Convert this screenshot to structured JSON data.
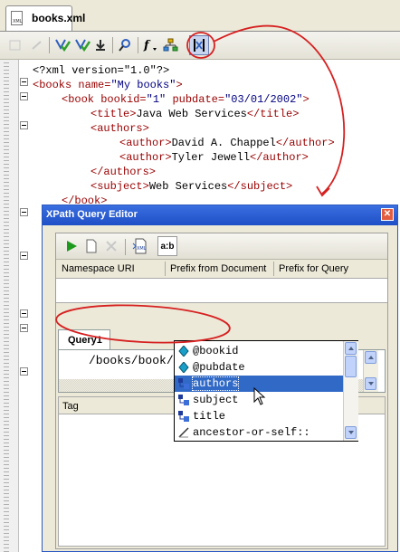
{
  "editor": {
    "tab_label": "books.xml",
    "file_icon_text": "XML",
    "toolbar_icons": [
      "validate-icon",
      "validate-all-icon",
      "insert-icon",
      "search-xpath-icon",
      "function-icon",
      "tree-icon",
      "xpath-query-editor-icon"
    ],
    "code_lines": [
      {
        "indent": 0,
        "parts": [
          {
            "t": "pi",
            "v": "<?xml version=\"1.0\"?>"
          }
        ]
      },
      {
        "indent": 0,
        "parts": [
          {
            "t": "tag",
            "v": "<books "
          },
          {
            "t": "attr",
            "v": "name="
          },
          {
            "t": "val",
            "v": "\"My books\""
          },
          {
            "t": "tag",
            "v": ">"
          }
        ]
      },
      {
        "indent": 1,
        "parts": [
          {
            "t": "tag",
            "v": "<book "
          },
          {
            "t": "attr",
            "v": "bookid="
          },
          {
            "t": "val",
            "v": "\"1\""
          },
          {
            "t": "attr",
            "v": " pubdate="
          },
          {
            "t": "val",
            "v": "\"03/01/2002\""
          },
          {
            "t": "tag",
            "v": ">"
          }
        ]
      },
      {
        "indent": 2,
        "parts": [
          {
            "t": "tag",
            "v": "<title>"
          },
          {
            "t": "txt",
            "v": "Java Web Services"
          },
          {
            "t": "tag",
            "v": "</title>"
          }
        ]
      },
      {
        "indent": 2,
        "parts": [
          {
            "t": "tag",
            "v": "<authors>"
          }
        ]
      },
      {
        "indent": 3,
        "parts": [
          {
            "t": "tag",
            "v": "<author>"
          },
          {
            "t": "txt",
            "v": "David A. Chappel"
          },
          {
            "t": "tag",
            "v": "</author>"
          }
        ]
      },
      {
        "indent": 3,
        "parts": [
          {
            "t": "tag",
            "v": "<author>"
          },
          {
            "t": "txt",
            "v": "Tyler Jewell"
          },
          {
            "t": "tag",
            "v": "</author>"
          }
        ]
      },
      {
        "indent": 2,
        "parts": [
          {
            "t": "tag",
            "v": "</authors>"
          }
        ]
      },
      {
        "indent": 2,
        "parts": [
          {
            "t": "tag",
            "v": "<subject>"
          },
          {
            "t": "txt",
            "v": "Web Services"
          },
          {
            "t": "tag",
            "v": "</subject>"
          }
        ]
      },
      {
        "indent": 1,
        "parts": [
          {
            "t": "tag",
            "v": "</book>"
          }
        ]
      }
    ]
  },
  "dialog": {
    "title": "XPath Query Editor",
    "close_glyph": "✕",
    "toolbar_icons": [
      "run-icon",
      "new-icon",
      "delete-icon",
      "xml-icon",
      "namespace-icon"
    ],
    "ns_button_label": "a:b",
    "namespace_columns": [
      "Namespace URI",
      "Prefix from Document",
      "Prefix for Query"
    ],
    "query_tab_label": "Query1",
    "query_text": "/books/book/a",
    "results_column": "Tag"
  },
  "autocomplete": {
    "items": [
      {
        "label": "@bookid",
        "icon": "attribute-icon",
        "selected": false
      },
      {
        "label": "@pubdate",
        "icon": "attribute-icon",
        "selected": false
      },
      {
        "label": "authors",
        "icon": "element-icon",
        "selected": true
      },
      {
        "label": "subject",
        "icon": "element-icon",
        "selected": false
      },
      {
        "label": "title",
        "icon": "element-icon",
        "selected": false
      },
      {
        "label": "ancestor-or-self::",
        "icon": "axis-icon",
        "selected": false
      }
    ]
  },
  "colors": {
    "tag": "#990000",
    "value": "#000080",
    "annotation": "#d62020",
    "selection": "#3169c6",
    "titlebar": "#1f4fc6"
  }
}
